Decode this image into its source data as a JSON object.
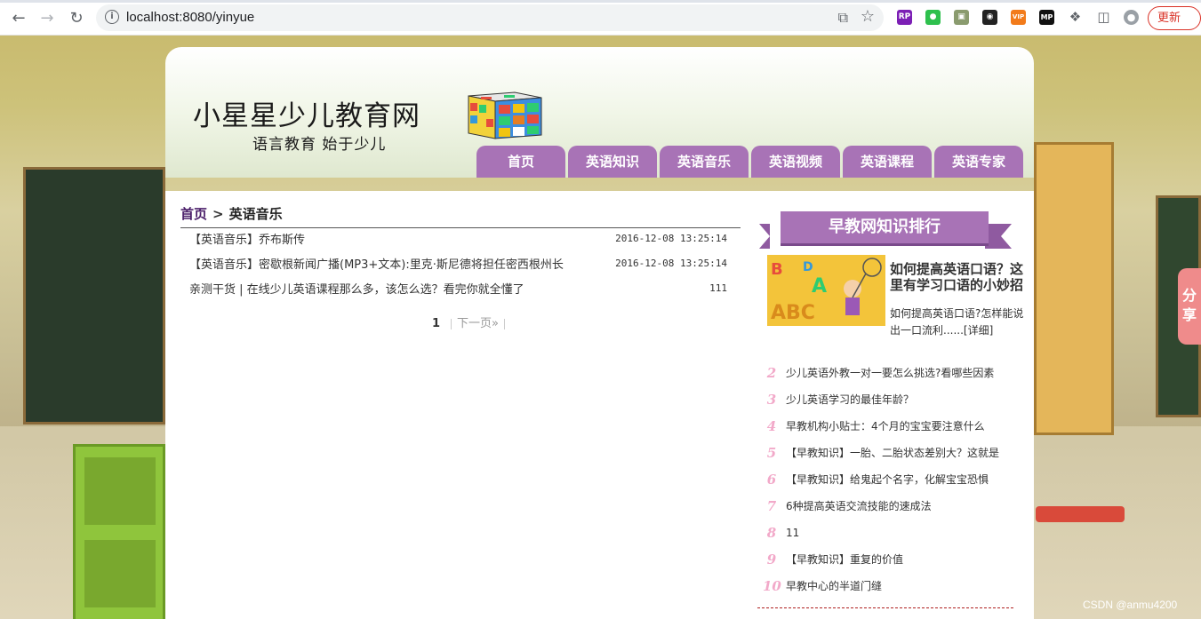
{
  "browser": {
    "url": "localhost:8080/yinyue",
    "update_label": "更新"
  },
  "site": {
    "title": "小星星少儿教育网",
    "slogan": "语言教育 始于少儿"
  },
  "nav": [
    "首页",
    "英语知识",
    "英语音乐",
    "英语视频",
    "英语课程",
    "英语专家"
  ],
  "breadcrumb": {
    "home": "首页",
    "separator": ">",
    "current": "英语音乐"
  },
  "articles": [
    {
      "title": "【英语音乐】乔布斯传",
      "meta": "2016-12-08 13:25:14"
    },
    {
      "title": "【英语音乐】密歇根新闻广播(MP3+文本):里克·斯尼德将担任密西根州长",
      "meta": "2016-12-08 13:25:14"
    },
    {
      "title": "亲测干货 | 在线少儿英语课程那么多，该怎么选？看完你就全懂了",
      "meta": "111"
    }
  ],
  "pagination": {
    "current": "1",
    "next": "下一页»"
  },
  "sidebar": {
    "rank_title": "早教网知识排行",
    "featured": {
      "title": "如何提高英语口语？这里有学习口语的小妙招",
      "desc": "如何提高英语口语?怎样能说出一口流利......[详细]"
    },
    "ranks": [
      {
        "num": "2",
        "text": "少儿英语外教一对一要怎么挑选?看哪些因素"
      },
      {
        "num": "3",
        "text": "少儿英语学习的最佳年龄？"
      },
      {
        "num": "4",
        "text": "早教机构小贴士：4个月的宝宝要注意什么"
      },
      {
        "num": "5",
        "text": "【早教知识】一胎、二胎状态差别大？这就是"
      },
      {
        "num": "6",
        "text": "【早教知识】给鬼起个名字，化解宝宝恐惧"
      },
      {
        "num": "7",
        "text": "6种提高英语交流技能的速成法"
      },
      {
        "num": "8",
        "text": "11"
      },
      {
        "num": "9",
        "text": "【早教知识】重复的价值"
      },
      {
        "num": "10",
        "text": "早教中心的半道门缝"
      }
    ]
  },
  "share_label": "分享",
  "watermark": "CSDN @anmu4200",
  "colors": {
    "nav_purple": "#a873b6",
    "rank_pink": "#f2a9c9"
  }
}
